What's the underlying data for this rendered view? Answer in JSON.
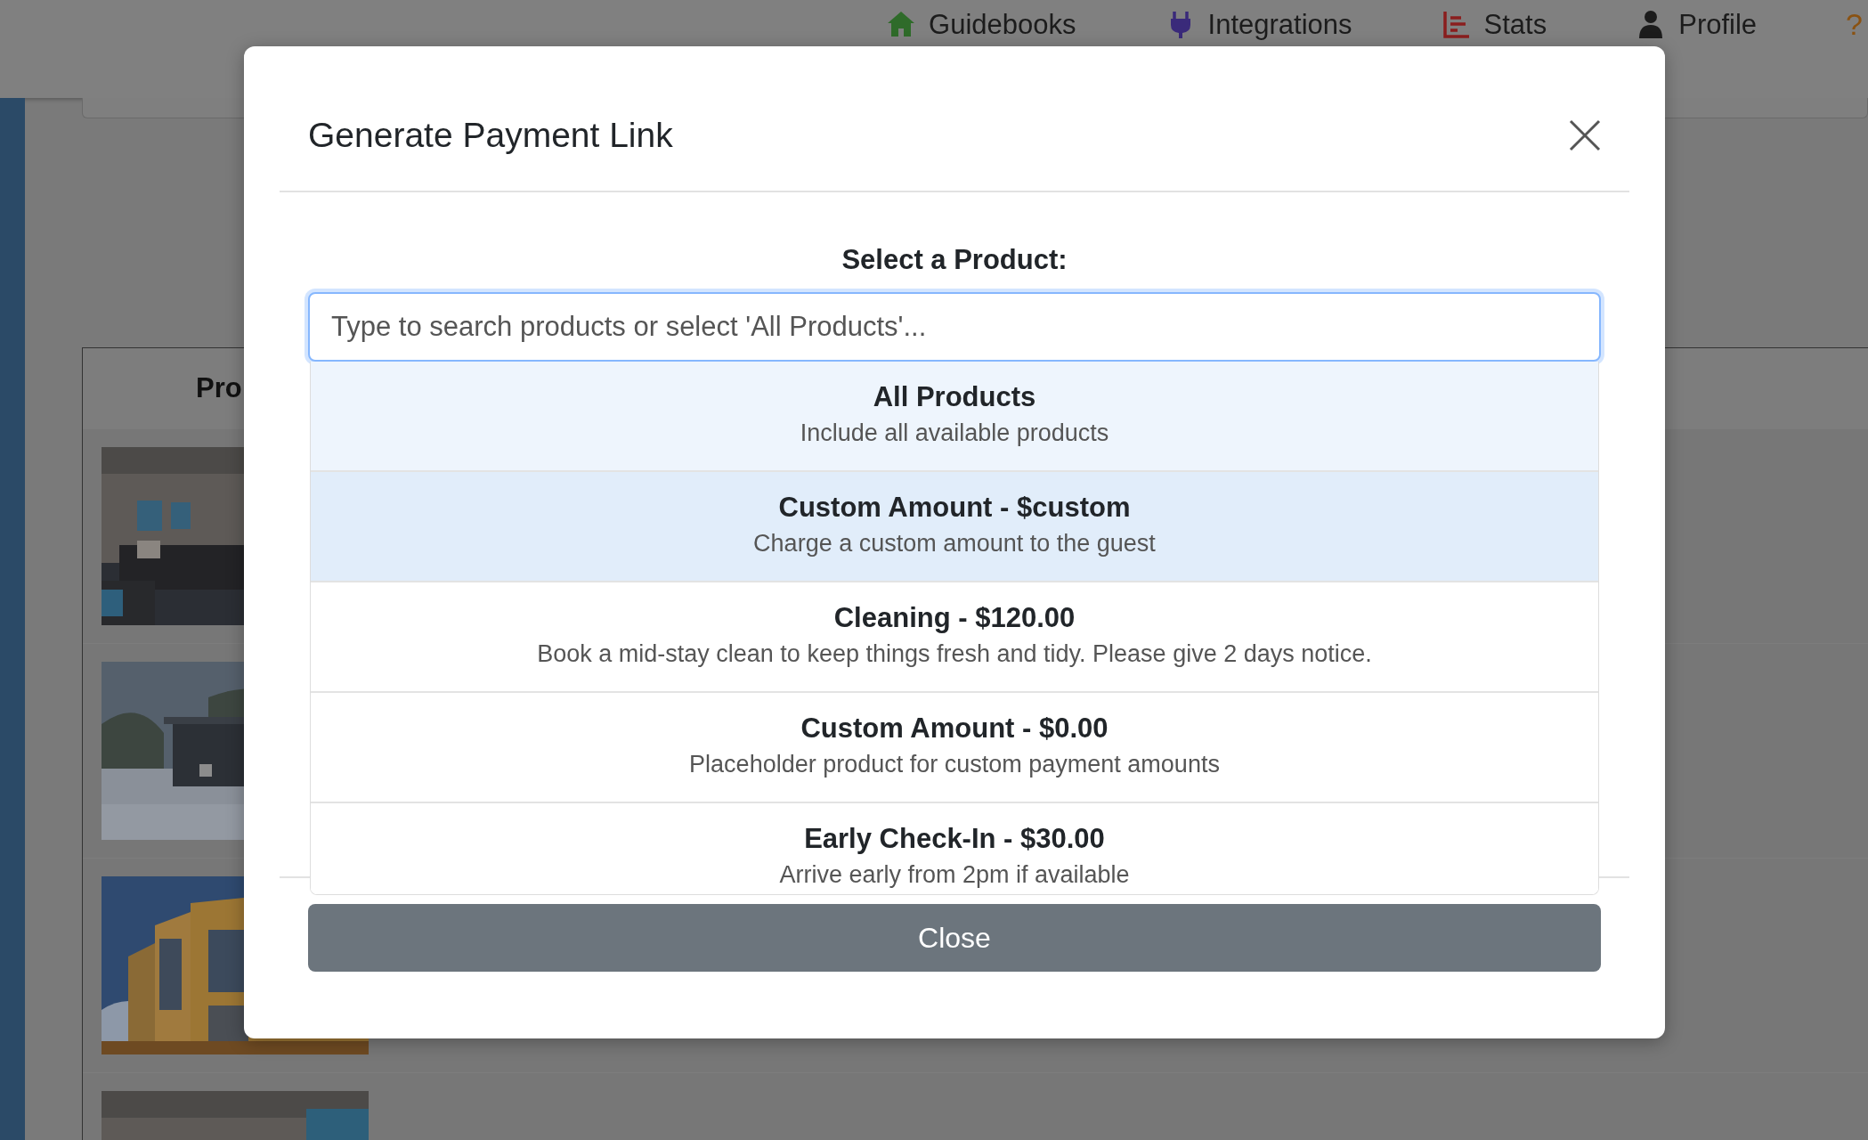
{
  "nav": [
    {
      "label": "Guidebooks",
      "kind": "house"
    },
    {
      "label": "Integrations",
      "kind": "plug"
    },
    {
      "label": "Stats",
      "kind": "chart"
    },
    {
      "label": "Profile",
      "kind": "person"
    },
    {
      "label": "?",
      "kind": "help"
    }
  ],
  "background": {
    "heading": "Pro"
  },
  "modal": {
    "title": "Generate Payment Link",
    "field_label": "Select a Product:",
    "search": {
      "placeholder": "Type to search products or select 'All Products'..."
    },
    "options": [
      {
        "kind": "all",
        "title": "All Products",
        "description": "Include all available products",
        "selected": false
      },
      {
        "kind": "product",
        "title": "Custom Amount - $custom",
        "description": "Charge a custom amount to the guest",
        "selected": true
      },
      {
        "kind": "product",
        "title": "Cleaning - $120.00",
        "description": "Book a mid-stay clean to keep things fresh and tidy. Please give 2 days notice.",
        "selected": false
      },
      {
        "kind": "product",
        "title": "Custom Amount - $0.00",
        "description": "Placeholder product for custom payment amounts",
        "selected": false
      },
      {
        "kind": "product",
        "title": "Early Check-In - $30.00",
        "description": "Arrive early from 2pm if available",
        "selected": false
      }
    ],
    "button": "Close"
  }
}
